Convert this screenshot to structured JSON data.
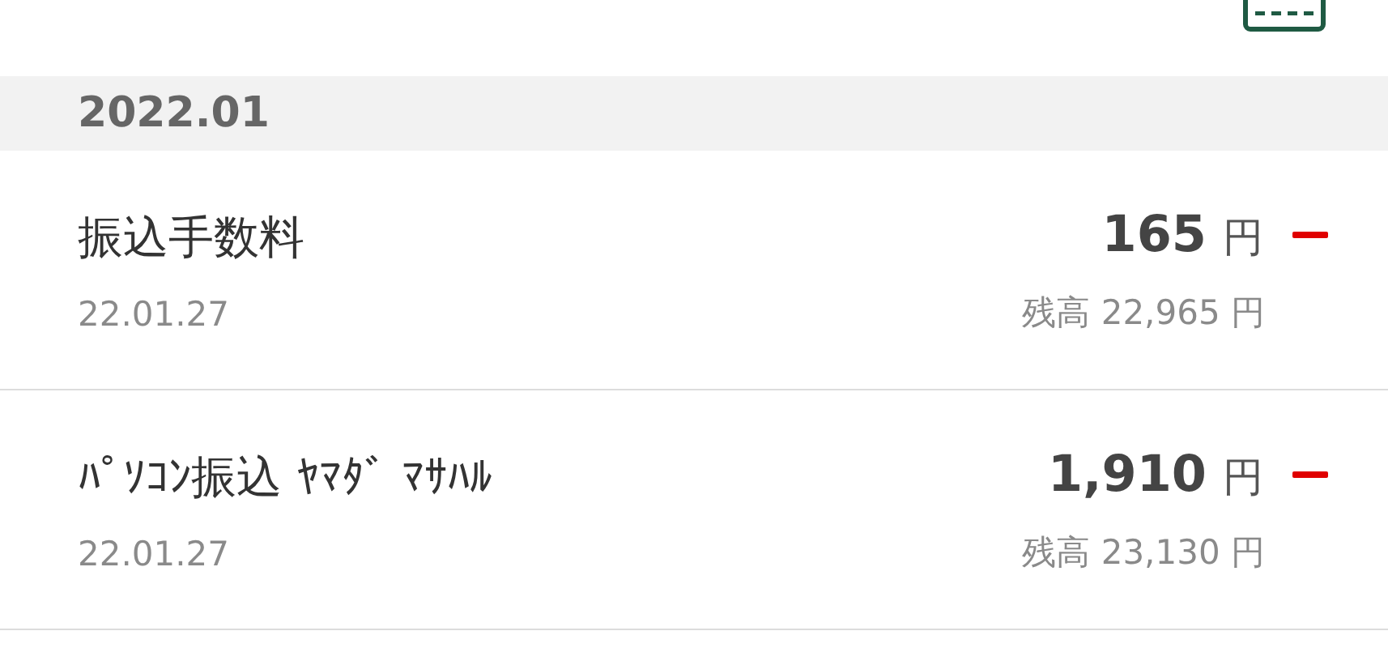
{
  "month_header": "2022.01",
  "transactions": [
    {
      "title": "振込手数料",
      "date": "22.01.27",
      "amount": "165",
      "currency": "円",
      "kind": "withdrawal",
      "balance": "残高 22,965 円"
    },
    {
      "title": "ﾊﾟｿｺﾝ振込 ﾔﾏﾀﾞ ﾏｻﾊﾙ",
      "date": "22.01.27",
      "amount": "1,910",
      "currency": "円",
      "kind": "withdrawal",
      "balance": "残高 23,130 円"
    }
  ]
}
